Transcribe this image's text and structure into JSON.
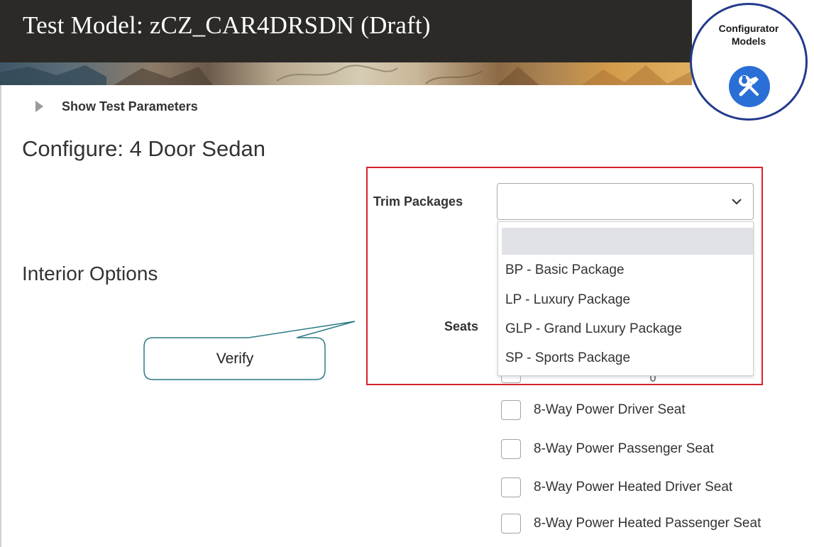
{
  "header": {
    "title": "Test Model: zCZ_CAR4DRSDN (Draft)"
  },
  "badge": {
    "line1": "Configurator",
    "line2": "Models",
    "icon": "tools-icon"
  },
  "test_params": {
    "label": "Show Test Parameters"
  },
  "configure": {
    "title": "Configure: 4 Door Sedan"
  },
  "trim": {
    "label": "Trim Packages",
    "selected": "",
    "options": [
      "",
      "BP - Basic Package",
      "LP - Luxury Package",
      "GLP - Grand Luxury Package",
      "SP - Sports Package"
    ]
  },
  "interior": {
    "title": "Interior Options"
  },
  "seats": {
    "label": "Seats",
    "options": [
      "8-Way Power Driver Seat",
      "8-Way Power Passenger Seat",
      "8-Way Power Heated Driver Seat",
      "8-Way Power Heated Passenger Seat"
    ]
  },
  "callout": {
    "text": "Verify"
  },
  "colors": {
    "header_bg": "#2b2a27",
    "highlight_border": "#d4222a",
    "badge_border": "#243a8c",
    "badge_icon": "#2a6fd6",
    "dropdown_highlight": "#e1e2e8"
  }
}
